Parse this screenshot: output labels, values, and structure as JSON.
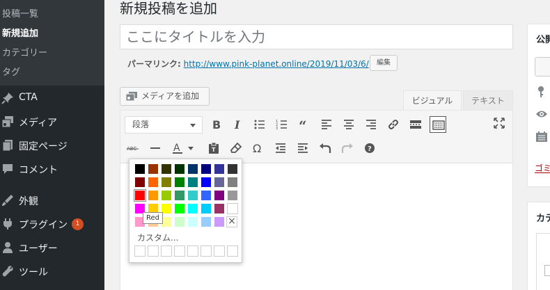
{
  "sidebar": {
    "submenu": [
      "投稿一覧",
      "新規追加",
      "カテゴリー",
      "タグ"
    ],
    "items": [
      {
        "label": "CTA",
        "icon": "pin-icon"
      },
      {
        "label": "メディア",
        "icon": "media-icon"
      },
      {
        "label": "固定ページ",
        "icon": "pages-icon"
      },
      {
        "label": "コメント",
        "icon": "comment-icon"
      },
      {
        "label": "外観",
        "icon": "appearance-icon"
      },
      {
        "label": "プラグイン",
        "icon": "plugin-icon",
        "badge": "1"
      },
      {
        "label": "ユーザー",
        "icon": "user-icon"
      },
      {
        "label": "ツール",
        "icon": "wrench-icon"
      }
    ]
  },
  "main": {
    "page_title": "新規投稿を追加",
    "title_placeholder": "ここにタイトルを入力",
    "permalink_label": "パーマリンク:",
    "permalink_url": "http://www.pink-planet.online/2019/11/03/6/",
    "edit_label": "編集",
    "add_media_label": "メディアを追加",
    "tab_visual": "ビジュアル",
    "tab_text": "テキスト",
    "format_select": "段落"
  },
  "color_picker": {
    "custom_label": "カスタム...",
    "tooltip": "Red",
    "colors": [
      [
        "#000000",
        "#993300",
        "#333300",
        "#003300",
        "#003366",
        "#000080",
        "#333399",
        "#333333"
      ],
      [
        "#800000",
        "#FF6600",
        "#808000",
        "#008000",
        "#008080",
        "#0000FF",
        "#666699",
        "#808080"
      ],
      [
        "#FF0000",
        "#FF9900",
        "#99CC00",
        "#339966",
        "#33CCCC",
        "#3366FF",
        "#800080",
        "#999999"
      ],
      [
        "#FF00FF",
        "#FFCC00",
        "#FFFF00",
        "#00FF00",
        "#00FFFF",
        "#00CCFF",
        "#993366",
        "#FFFFFF"
      ],
      [
        "#FF99CC",
        "#FFCC99",
        "#FFFF99",
        "#CCFFCC",
        "#CCFFFF",
        "#99CCFF",
        "#CC99FF",
        ""
      ]
    ]
  },
  "right": {
    "publish_title": "公開",
    "cat_title": "カテ"
  }
}
